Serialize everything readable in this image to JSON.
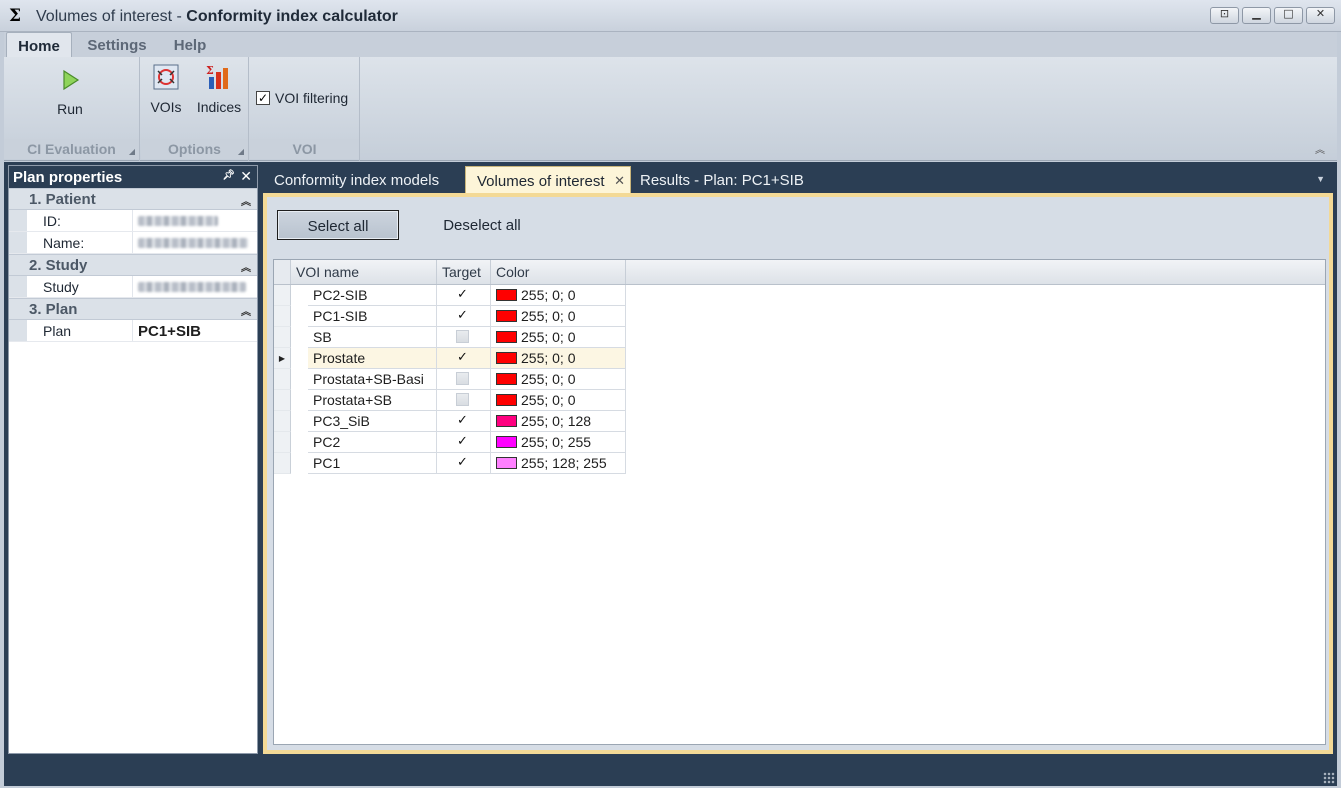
{
  "window": {
    "title_prefix": "Volumes of interest",
    "title_separator": " - ",
    "title_app": "Conformity index calculator",
    "app_icon": "Σ",
    "buttons": [
      "restore-down-icon",
      "minimize-icon",
      "maximize-icon",
      "close-icon"
    ]
  },
  "ribbon": {
    "tabs": [
      {
        "label": "Home",
        "active": true
      },
      {
        "label": "Settings",
        "active": false
      },
      {
        "label": "Help",
        "active": false
      }
    ],
    "groups": {
      "ci_evaluation": {
        "label": "CI Evaluation",
        "run_label": "Run",
        "run_icon": "play-icon"
      },
      "options": {
        "label": "Options",
        "vois_label": "VOIs",
        "indices_label": "Indices",
        "vois_icon": "vois-icon",
        "indices_icon": "indices-chart-icon"
      },
      "voi": {
        "label": "VOI",
        "filtering_label": "VOI filtering",
        "filtering_checked": true
      }
    }
  },
  "plan_properties": {
    "title": "Plan properties",
    "categories": [
      {
        "label": "1. Patient",
        "rows": [
          {
            "key": "ID:",
            "value": "",
            "blurred": true
          },
          {
            "key": "Name:",
            "value": "",
            "blurred": true
          }
        ]
      },
      {
        "label": "2. Study",
        "rows": [
          {
            "key": "Study",
            "value": "",
            "blurred": true
          }
        ]
      },
      {
        "label": "3. Plan",
        "rows": [
          {
            "key": "Plan",
            "value": "PC1+SIB",
            "blurred": false
          }
        ]
      }
    ]
  },
  "doc_tabs": [
    {
      "label": "Conformity index models",
      "active": false
    },
    {
      "label": "Volumes of interest",
      "active": true
    },
    {
      "label": "Results - Plan: PC1+SIB",
      "active": false
    }
  ],
  "voi_panel": {
    "select_all_label": "Select all",
    "deselect_all_label": "Deselect all",
    "columns": [
      "VOI name",
      "Target",
      "Color"
    ],
    "rows": [
      {
        "name": "PC2-SIB",
        "target": true,
        "color_text": "255; 0; 0",
        "color_hex": "#ff0000",
        "selected": false
      },
      {
        "name": "PC1-SIB",
        "target": true,
        "color_text": "255; 0; 0",
        "color_hex": "#ff0000",
        "selected": false
      },
      {
        "name": "SB",
        "target": false,
        "color_text": "255; 0; 0",
        "color_hex": "#ff0000",
        "selected": false
      },
      {
        "name": "Prostate",
        "target": true,
        "color_text": "255; 0; 0",
        "color_hex": "#ff0000",
        "selected": true
      },
      {
        "name": "Prostata+SB-Basi",
        "target": false,
        "color_text": "255; 0; 0",
        "color_hex": "#ff0000",
        "selected": false
      },
      {
        "name": "Prostata+SB",
        "target": false,
        "color_text": "255; 0; 0",
        "color_hex": "#ff0000",
        "selected": false
      },
      {
        "name": "PC3_SiB",
        "target": true,
        "color_text": "255; 0; 128",
        "color_hex": "#ff0080",
        "selected": false
      },
      {
        "name": "PC2",
        "target": true,
        "color_text": "255; 0; 255",
        "color_hex": "#ff00ff",
        "selected": false
      },
      {
        "name": "PC1",
        "target": true,
        "color_text": "255; 128; 255",
        "color_hex": "#ff80ff",
        "selected": false
      }
    ]
  }
}
